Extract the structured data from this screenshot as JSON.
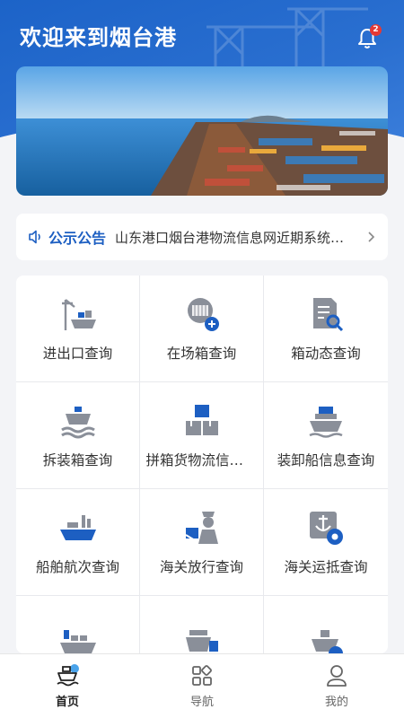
{
  "header": {
    "title": "欢迎来到烟台港",
    "notification_count": "2"
  },
  "notice": {
    "tag": "公示公告",
    "message": "山东港口烟台港物流信息网近期系统升级公告"
  },
  "services": [
    {
      "label": "进出口查询",
      "icon": "crane-ship-icon"
    },
    {
      "label": "在场箱查询",
      "icon": "container-yard-icon"
    },
    {
      "label": "箱动态查询",
      "icon": "document-search-icon"
    },
    {
      "label": "拆装箱查询",
      "icon": "ship-waves-icon"
    },
    {
      "label": "拼箱货物流信息查询",
      "icon": "boxes-icon"
    },
    {
      "label": "装卸船信息查询",
      "icon": "cargo-ship-icon"
    },
    {
      "label": "船舶航次查询",
      "icon": "vessel-icon"
    },
    {
      "label": "海关放行查询",
      "icon": "customs-officer-icon"
    },
    {
      "label": "海关运抵查询",
      "icon": "anchor-gear-icon"
    },
    {
      "label": "",
      "icon": "container-ship-icon"
    },
    {
      "label": "",
      "icon": "ship-containers-icon"
    },
    {
      "label": "",
      "icon": "inspection-ship-icon"
    }
  ],
  "tabbar": {
    "tabs": [
      {
        "label": "首页",
        "icon": "home-ship-icon",
        "active": true
      },
      {
        "label": "导航",
        "icon": "grid-apps-icon",
        "active": false
      },
      {
        "label": "我的",
        "icon": "user-icon",
        "active": false
      }
    ]
  },
  "colors": {
    "brand": "#1d5fc2",
    "icon_gray": "#8a8f99",
    "badge": "#e53935"
  }
}
